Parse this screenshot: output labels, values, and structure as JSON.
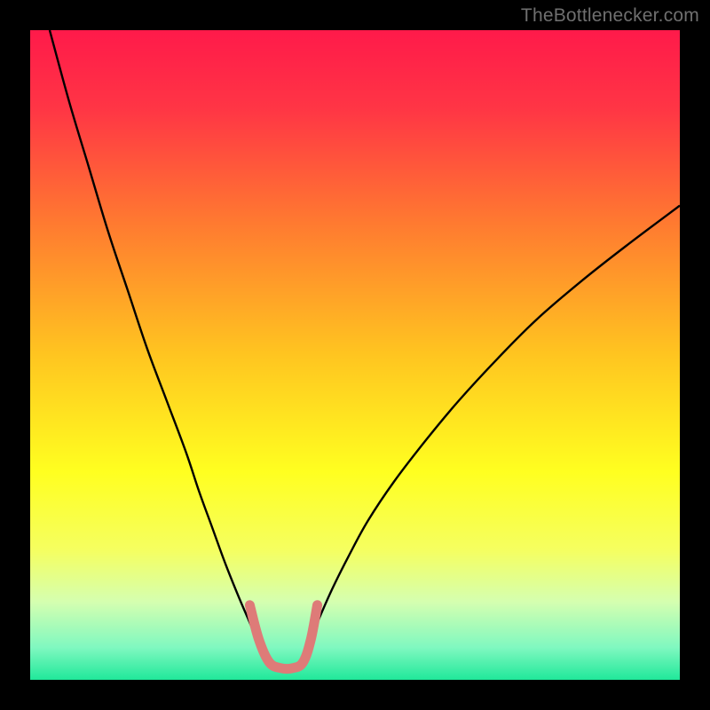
{
  "watermark": "TheBottlenecker.com",
  "chart_data": {
    "type": "line",
    "title": "",
    "xlabel": "",
    "ylabel": "",
    "xlim": [
      0,
      100
    ],
    "ylim": [
      0,
      100
    ],
    "grid": false,
    "background_gradient": {
      "stops": [
        {
          "offset": 0.0,
          "color": "#ff1a4a"
        },
        {
          "offset": 0.12,
          "color": "#ff3545"
        },
        {
          "offset": 0.3,
          "color": "#ff7b30"
        },
        {
          "offset": 0.5,
          "color": "#ffc520"
        },
        {
          "offset": 0.68,
          "color": "#ffff20"
        },
        {
          "offset": 0.8,
          "color": "#f5ff60"
        },
        {
          "offset": 0.88,
          "color": "#d5ffb0"
        },
        {
          "offset": 0.95,
          "color": "#80f8c0"
        },
        {
          "offset": 1.0,
          "color": "#20e89a"
        }
      ]
    },
    "series": [
      {
        "name": "left-curve",
        "stroke": "#000000",
        "stroke_width": 2.4,
        "x": [
          3,
          6,
          9,
          12,
          15,
          18,
          21,
          24,
          26,
          28,
          30,
          32,
          33.5,
          35,
          36.2
        ],
        "y": [
          100,
          89,
          79,
          69,
          60,
          51,
          43,
          35,
          29,
          23.5,
          18,
          13,
          9.5,
          6,
          3.2
        ]
      },
      {
        "name": "right-curve",
        "stroke": "#000000",
        "stroke_width": 2.4,
        "x": [
          41.8,
          43,
          44.5,
          46.5,
          49,
          52,
          56,
          61,
          66,
          72,
          78,
          85,
          92,
          100
        ],
        "y": [
          3.2,
          6,
          9.5,
          14,
          19,
          24.5,
          30.5,
          37,
          43,
          49.5,
          55.5,
          61.5,
          67,
          73
        ]
      },
      {
        "name": "valley-floor",
        "stroke": "#de7b78",
        "stroke_width": 11,
        "linecap": "round",
        "x": [
          33.8,
          35.2,
          36.8,
          38.6,
          40.4,
          42.0,
          43.2,
          44.2
        ],
        "y": [
          11.5,
          6.2,
          2.7,
          1.8,
          1.8,
          2.7,
          6.2,
          11.5
        ]
      }
    ]
  }
}
